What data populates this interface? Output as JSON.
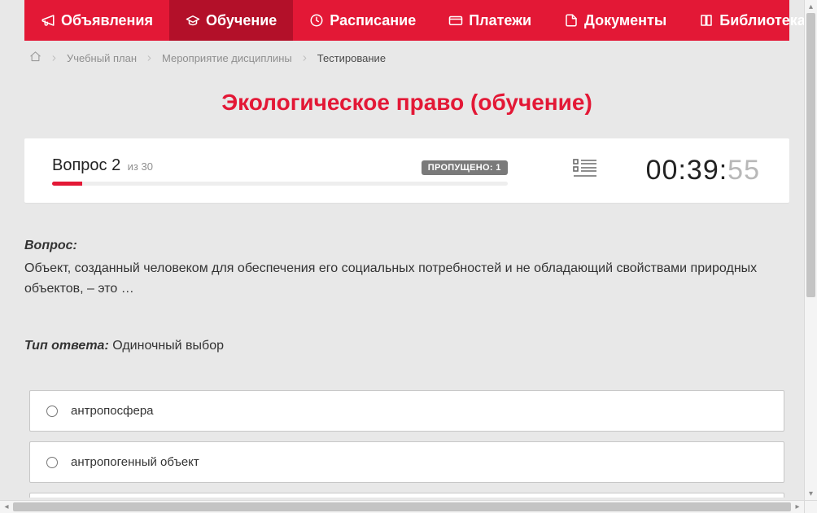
{
  "nav": {
    "items": [
      {
        "label": "Объявления",
        "icon": "megaphone",
        "active": false
      },
      {
        "label": "Обучение",
        "icon": "graduation",
        "active": true
      },
      {
        "label": "Расписание",
        "icon": "clock",
        "active": false
      },
      {
        "label": "Платежи",
        "icon": "card",
        "active": false
      },
      {
        "label": "Документы",
        "icon": "doc",
        "active": false
      },
      {
        "label": "Библиотека",
        "icon": "book",
        "active": false,
        "dropdown": true
      }
    ]
  },
  "breadcrumbs": {
    "items": [
      {
        "label": "Учебный план"
      },
      {
        "label": "Мероприятие дисциплины"
      }
    ],
    "current": "Тестирование"
  },
  "page_title": "Экологическое право (обучение)",
  "status": {
    "question_label": "Вопрос 2",
    "of_text": "из 30",
    "skipped_badge": "ПРОПУЩЕНО: 1",
    "timer_main": "00:39:",
    "timer_sec": "55"
  },
  "question": {
    "label": "Вопрос:",
    "text": "Объект, созданный человеком для обеспечения его социальных потребностей и не обладающий свойствами природных объектов, – это …",
    "answer_type_label": "Тип ответа:",
    "answer_type_value": "Одиночный выбор"
  },
  "answers": [
    {
      "text": "антропосфера"
    },
    {
      "text": "антропогенный объект"
    }
  ]
}
